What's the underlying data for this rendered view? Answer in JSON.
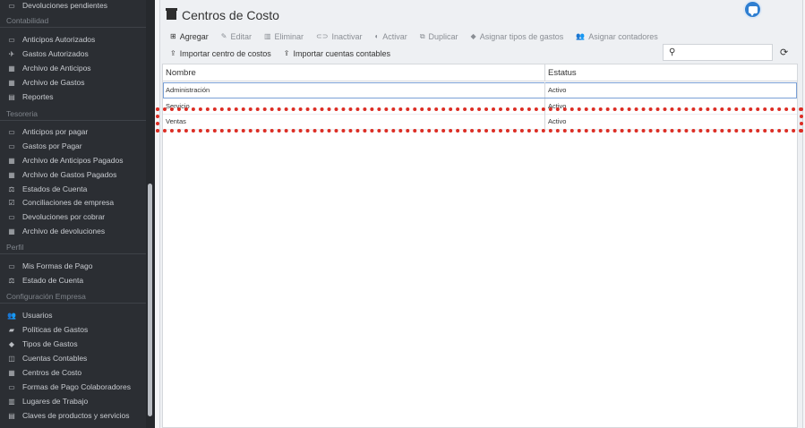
{
  "sidebar": {
    "items": [
      {
        "key": "devoluciones-pendientes",
        "label": "Devoluciones pendientes",
        "icon": "money-icon",
        "glyph": "▭"
      },
      {
        "key": "anticipos-autorizados",
        "label": "Anticipos Autorizados",
        "icon": "money-icon",
        "glyph": "▭"
      },
      {
        "key": "gastos-autorizados",
        "label": "Gastos Autorizados",
        "icon": "plane-icon",
        "glyph": "✈"
      },
      {
        "key": "archivo-anticipos",
        "label": "Archivo de Anticipos",
        "icon": "archive-icon",
        "glyph": "▦"
      },
      {
        "key": "archivo-gastos",
        "label": "Archivo de Gastos",
        "icon": "archive-icon",
        "glyph": "▦"
      },
      {
        "key": "reportes",
        "label": "Reportes",
        "icon": "table-icon",
        "glyph": "▤"
      },
      {
        "key": "anticipos-por-pagar",
        "label": "Anticipos por pagar",
        "icon": "money-icon",
        "glyph": "▭"
      },
      {
        "key": "gastos-por-pagar",
        "label": "Gastos por Pagar",
        "icon": "money-icon",
        "glyph": "▭"
      },
      {
        "key": "archivo-anticipos-pagados",
        "label": "Archivo de Anticipos Pagados",
        "icon": "archive-icon",
        "glyph": "▦"
      },
      {
        "key": "archivo-gastos-pagados",
        "label": "Archivo de Gastos Pagados",
        "icon": "archive-icon",
        "glyph": "▦"
      },
      {
        "key": "estados-de-cuenta",
        "label": "Estados de Cuenta",
        "icon": "scale-icon",
        "glyph": "⚖"
      },
      {
        "key": "conciliaciones-empresa",
        "label": "Conciliaciones de empresa",
        "icon": "check-square-icon",
        "glyph": "☑"
      },
      {
        "key": "devoluciones-por-cobrar",
        "label": "Devoluciones por cobrar",
        "icon": "money-icon",
        "glyph": "▭"
      },
      {
        "key": "archivo-devoluciones",
        "label": "Archivo de devoluciones",
        "icon": "archive-icon",
        "glyph": "▦"
      },
      {
        "key": "mis-formas-de-pago",
        "label": "Mis Formas de Pago",
        "icon": "credit-card-icon",
        "glyph": "▭"
      },
      {
        "key": "estado-de-cuenta",
        "label": "Estado de Cuenta",
        "icon": "scale-icon",
        "glyph": "⚖"
      },
      {
        "key": "usuarios",
        "label": "Usuarios",
        "icon": "users-icon",
        "glyph": "👥"
      },
      {
        "key": "politicas-de-gastos",
        "label": "Políticas de Gastos",
        "icon": "book-icon",
        "glyph": "▰"
      },
      {
        "key": "tipos-de-gastos",
        "label": "Tipos de Gastos",
        "icon": "tags-icon",
        "glyph": "◆"
      },
      {
        "key": "cuentas-contables",
        "label": "Cuentas Contables",
        "icon": "columns-icon",
        "glyph": "◫"
      },
      {
        "key": "centros-de-costo",
        "label": "Centros de Costo",
        "icon": "archive-icon",
        "glyph": "▦"
      },
      {
        "key": "formas-pago-colaboradores",
        "label": "Formas de Pago Colaboradores",
        "icon": "credit-card-icon",
        "glyph": "▭"
      },
      {
        "key": "lugares-de-trabajo",
        "label": "Lugares de Trabajo",
        "icon": "building-icon",
        "glyph": "▥"
      },
      {
        "key": "claves-productos-servicios",
        "label": "Claves de productos y servicios",
        "icon": "cart-icon",
        "glyph": "▤"
      }
    ],
    "sections": {
      "contabilidad": "Contabilidad",
      "tesoreria": "Tesoreria",
      "perfil": "Perfil",
      "configuracion": "Configuración Empresa"
    }
  },
  "page": {
    "title": "Centros de Costo"
  },
  "toolbar": {
    "agregar": "Agregar",
    "editar": "Editar",
    "eliminar": "Eliminar",
    "inactivar": "Inactivar",
    "activar": "Activar",
    "duplicar": "Duplicar",
    "asignar_tipos": "Asignar tipos de gastos",
    "asignar_contadores": "Asignar contadores",
    "importar_centro": "Importar centro de costos",
    "importar_cuentas": "Importar cuentas contables"
  },
  "search": {
    "value": "",
    "placeholder": ""
  },
  "grid": {
    "columns": [
      "Nombre",
      "Estatus"
    ],
    "rows": [
      [
        "Administración",
        "Activo"
      ],
      [
        "Servicio",
        "Activo"
      ],
      [
        "Ventas",
        "Activo"
      ]
    ]
  },
  "colors": {
    "sidebar_bg": "#2b2e33",
    "accent": "#2f7fd1",
    "highlight_dots": "#dc2d24"
  }
}
